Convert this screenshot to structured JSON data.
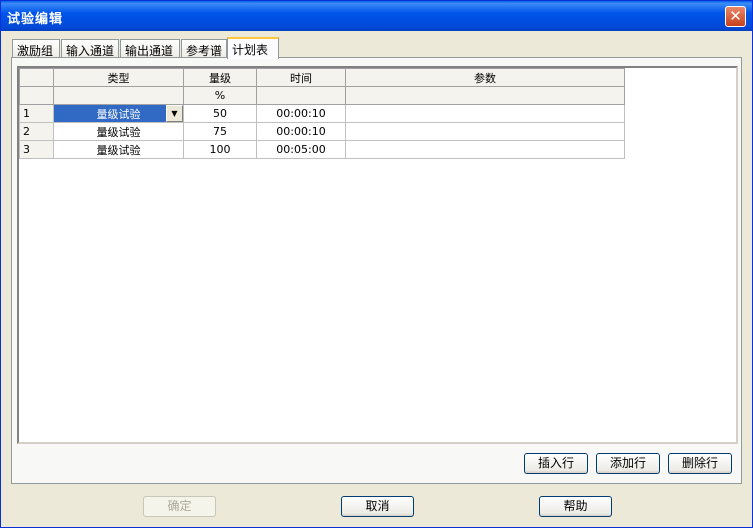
{
  "window": {
    "title": "试验编辑",
    "close_glyph": "✕"
  },
  "tabs": [
    {
      "label": "激励组",
      "active": false
    },
    {
      "label": "输入通道",
      "active": false
    },
    {
      "label": "输出通道",
      "active": false
    },
    {
      "label": "参考谱",
      "active": false
    },
    {
      "label": "计划表",
      "active": true
    }
  ],
  "grid": {
    "headers": [
      "类型",
      "量级",
      "时间",
      "参数"
    ],
    "units": [
      "",
      "%",
      "",
      ""
    ],
    "rows": [
      {
        "num": "1",
        "type": "量级试验",
        "level": "50",
        "time": "00:00:10",
        "param": ""
      },
      {
        "num": "2",
        "type": "量级试验",
        "level": "75",
        "time": "00:00:10",
        "param": ""
      },
      {
        "num": "3",
        "type": "量级试验",
        "level": "100",
        "time": "00:05:00",
        "param": ""
      }
    ]
  },
  "row_buttons": {
    "insert": "插入行",
    "add": "添加行",
    "delete": "删除行"
  },
  "dialog_buttons": {
    "ok": "确定",
    "cancel": "取消",
    "help": "帮助"
  }
}
